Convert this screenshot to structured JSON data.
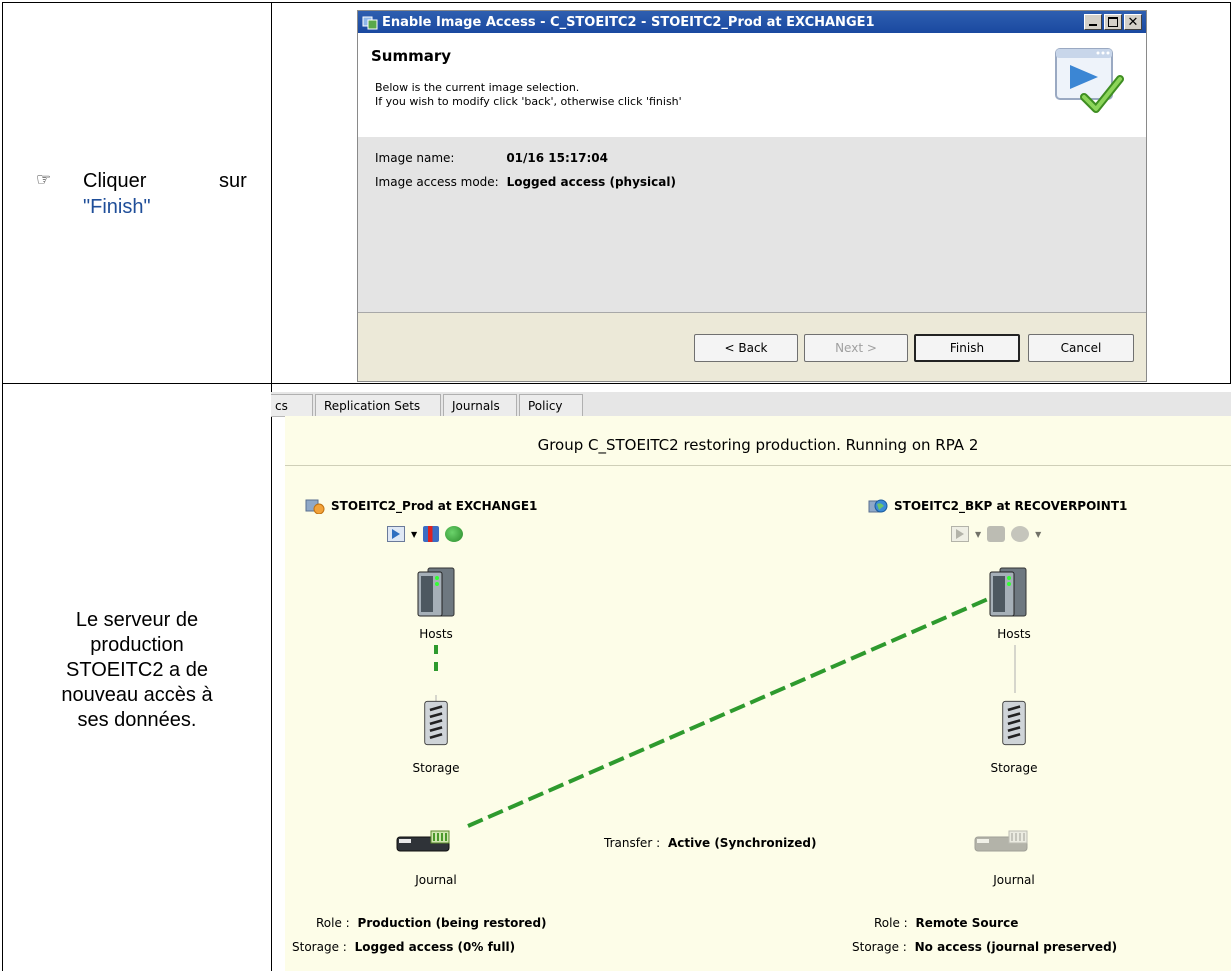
{
  "row1": {
    "instruction": {
      "bullet": "☞",
      "text1": "Cliquer",
      "text2": "sur",
      "link": "\"Finish\""
    }
  },
  "dialog": {
    "title": "Enable Image Access - C_STOEITC2 - STOEITC2_Prod at EXCHANGE1",
    "header_title": "Summary",
    "header_line1": "Below is the current image selection.",
    "header_line2": "If you wish to modify click 'back', otherwise click 'finish'",
    "image_name_label": "Image name:",
    "image_name_value": "01/16 15:17:04",
    "access_mode_label": "Image access mode:",
    "access_mode_value": "Logged access (physical)",
    "buttons": {
      "back": "< Back",
      "next": "Next >",
      "finish": "Finish",
      "cancel": "Cancel"
    }
  },
  "row2": {
    "description": [
      "Le serveur de",
      "production",
      "STOEITC2 a de",
      "nouveau accès à",
      "ses données."
    ]
  },
  "group_view": {
    "tabs": [
      "cs",
      "Replication Sets",
      "Journals",
      "Policy"
    ],
    "title": "Group C_STOEITC2 restoring production. Running on  RPA 2",
    "left_site": {
      "name": "STOEITC2_Prod at EXCHANGE1",
      "hosts": "Hosts",
      "storage": "Storage",
      "journal": "Journal",
      "role_label": "Role :",
      "role_value": "Production (being restored)",
      "storage_label": "Storage :",
      "storage_value": "Logged access (0% full)"
    },
    "right_site": {
      "name": "STOEITC2_BKP at RECOVERPOINT1",
      "hosts": "Hosts",
      "storage": "Storage",
      "journal": "Journal",
      "role_label": "Role :",
      "role_value": "Remote Source",
      "storage_label": "Storage :",
      "storage_value": "No access (journal preserved)"
    },
    "transfer_label": "Transfer :",
    "transfer_value": "Active (Synchronized)"
  },
  "colors": {
    "link": "#1f4e99",
    "link_line": "#2e9a2e",
    "panel_bg": "#fdfde8"
  }
}
